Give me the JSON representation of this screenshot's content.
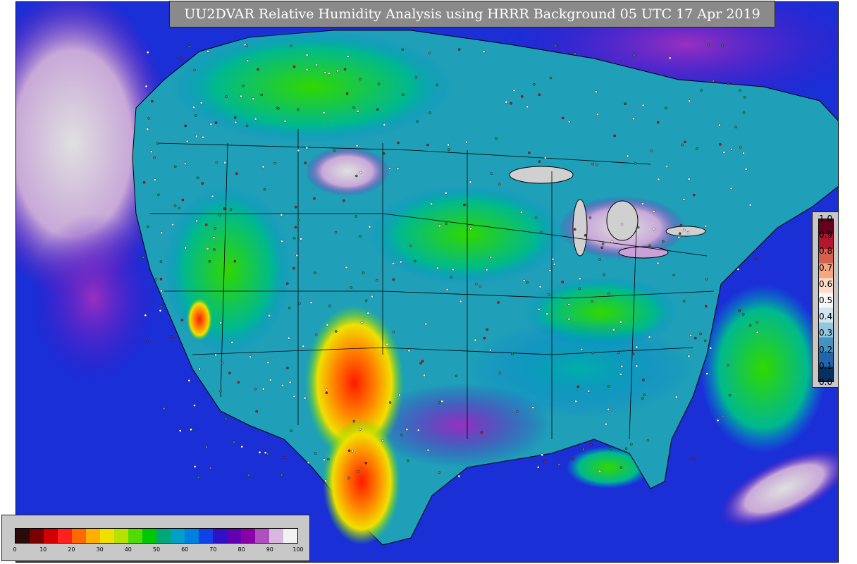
{
  "title": "UU2DVAR Relative Humidity Analysis using HRRR Background 05 UTC 17 Apr 2019",
  "rh_colorbar": {
    "ticks": [
      "0",
      "10",
      "20",
      "30",
      "40",
      "50",
      "60",
      "70",
      "80",
      "90",
      "100"
    ],
    "colors": [
      "#2b0a0a",
      "#7a0000",
      "#d40000",
      "#ff2020",
      "#ff6a00",
      "#ffb000",
      "#f0e000",
      "#b8e000",
      "#50dc00",
      "#00c800",
      "#00a878",
      "#00a0c8",
      "#0080e0",
      "#1040e8",
      "#3010c8",
      "#6000b0",
      "#8a00a8",
      "#b050c0",
      "#d8b8e0",
      "#f2f2f2"
    ]
  },
  "increment_colorbar": {
    "ticks": [
      "1.0",
      "0.9",
      "0.8",
      "0.7",
      "0.6",
      "0.5",
      "0.4",
      "0.3",
      "0.2",
      "0.1",
      "0.0"
    ],
    "colors": [
      "#67001f",
      "#b2182b",
      "#d6604d",
      "#f4a582",
      "#fddbc7",
      "#f7f7f7",
      "#d1e5f0",
      "#92c5de",
      "#4393c3",
      "#2166ac",
      "#053061"
    ]
  },
  "colors": {
    "ocean": "#1a2fd6",
    "dry": "#ff1a00",
    "moist": "#00c800",
    "saturated": "#d8d8d8",
    "boundary": "#000000"
  }
}
